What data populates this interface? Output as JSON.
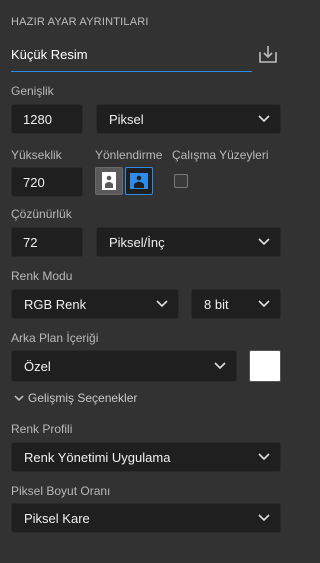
{
  "panel": {
    "title": "HAZIR AYAR AYRINTILARI"
  },
  "preset": {
    "name": "Küçük Resim",
    "save_icon": "save-download-icon"
  },
  "width": {
    "label": "Genişlik",
    "value": "1280",
    "unit": "Piksel"
  },
  "height": {
    "label": "Yükseklik",
    "value": "720"
  },
  "orientation": {
    "label": "Yönlendirme",
    "selected": "landscape"
  },
  "artboards": {
    "label": "Çalışma Yüzeyleri",
    "checked": false
  },
  "resolution": {
    "label": "Çözünürlük",
    "value": "72",
    "unit": "Piksel/İnç"
  },
  "color_mode": {
    "label": "Renk Modu",
    "mode": "RGB Renk",
    "depth": "8 bit"
  },
  "background": {
    "label": "Arka Plan İçeriği",
    "value": "Özel",
    "swatch_color": "#ffffff"
  },
  "advanced": {
    "label": "Gelişmiş Seçenekler"
  },
  "color_profile": {
    "label": "Renk Profili",
    "value": "Renk Yönetimi Uygulama"
  },
  "pixel_aspect": {
    "label": "Piksel Boyut Oranı",
    "value": "Piksel Kare"
  },
  "colors": {
    "accent": "#2d8ceb",
    "panel_bg": "#323232",
    "field_bg": "#1f1f1f"
  }
}
